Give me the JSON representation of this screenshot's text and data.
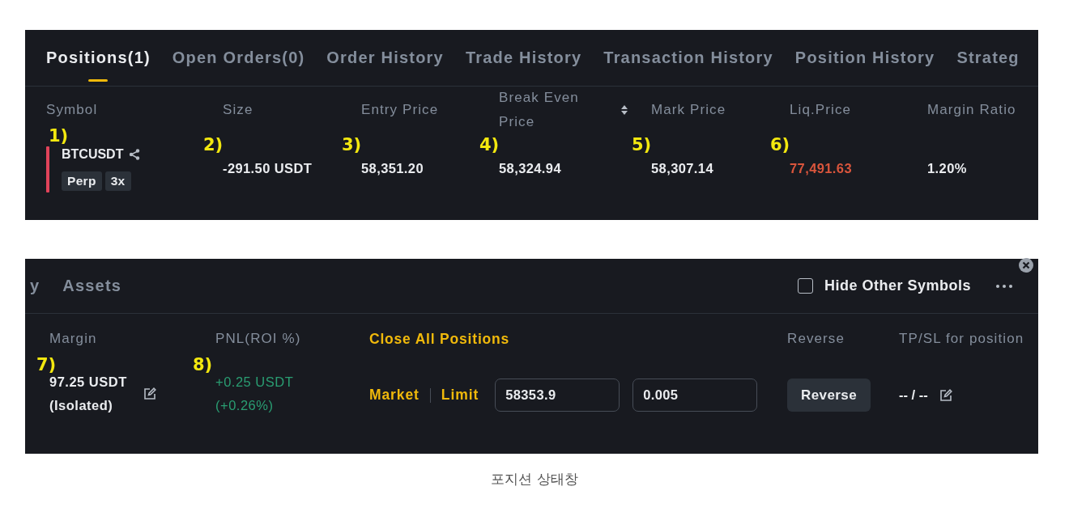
{
  "positions_panel": {
    "tabs": [
      {
        "label": "Positions(1)",
        "selected": true
      },
      {
        "label": "Open Orders(0)",
        "selected": false
      },
      {
        "label": "Order History",
        "selected": false
      },
      {
        "label": "Trade History",
        "selected": false
      },
      {
        "label": "Transaction History",
        "selected": false
      },
      {
        "label": "Position History",
        "selected": false
      },
      {
        "label": "Strateg",
        "selected": false
      }
    ],
    "columns": [
      {
        "kind": "symbol",
        "header": "Symbol",
        "sortable": false,
        "annotation": "1)",
        "symbol": "BTCUSDT",
        "color": "#e0435a",
        "tags": [
          "Perp",
          "3x"
        ]
      },
      {
        "kind": "value",
        "header": "Size",
        "sortable": false,
        "annotation": "2)",
        "value": "-291.50 USDT",
        "color": "#eaecef"
      },
      {
        "kind": "value",
        "header": "Entry Price",
        "sortable": false,
        "annotation": "3)",
        "value": "58,351.20",
        "color": "#eaecef"
      },
      {
        "kind": "value",
        "header": "Break Even Price",
        "sortable": true,
        "annotation": "4)",
        "value": "58,324.94",
        "color": "#eaecef"
      },
      {
        "kind": "value",
        "header": "Mark Price",
        "sortable": false,
        "annotation": "5)",
        "value": "58,307.14",
        "color": "#eaecef"
      },
      {
        "kind": "value",
        "header": "Liq.Price",
        "sortable": false,
        "annotation": "6)",
        "value": "77,491.63",
        "color": "#d9553c"
      },
      {
        "kind": "value",
        "header": "Margin Ratio",
        "sortable": false,
        "value": "1.20%",
        "color": "#eaecef"
      }
    ]
  },
  "actions_panel": {
    "tabs": [
      {
        "label": "y",
        "selected": false
      },
      {
        "label": "Assets",
        "selected": false
      }
    ],
    "hide_other_symbols": {
      "label": "Hide Other Symbols",
      "checked": false
    },
    "columns": [
      {
        "kind": "stacked",
        "header": "Margin",
        "annotation": "7)",
        "lines": [
          "97.25 USDT",
          "(Isolated)"
        ],
        "editable": true,
        "color": "#eaecef"
      },
      {
        "kind": "stacked",
        "header": "PNL(ROI %)",
        "annotation": "8)",
        "lines": [
          "+0.25 USDT",
          "(+0.26%)"
        ],
        "editable": false,
        "color": "#2a9d72"
      },
      {
        "kind": "close",
        "header": "Close All Positions",
        "order_types": [
          "Market",
          "Limit"
        ],
        "fields": [
          "58353.9",
          "0.005"
        ]
      },
      {
        "kind": "button",
        "header": "Reverse",
        "button": "Reverse"
      },
      {
        "kind": "tpsl",
        "header": "TP/SL for position",
        "value": "-- / --",
        "editable": true
      }
    ]
  },
  "caption": "포지션 상태창"
}
